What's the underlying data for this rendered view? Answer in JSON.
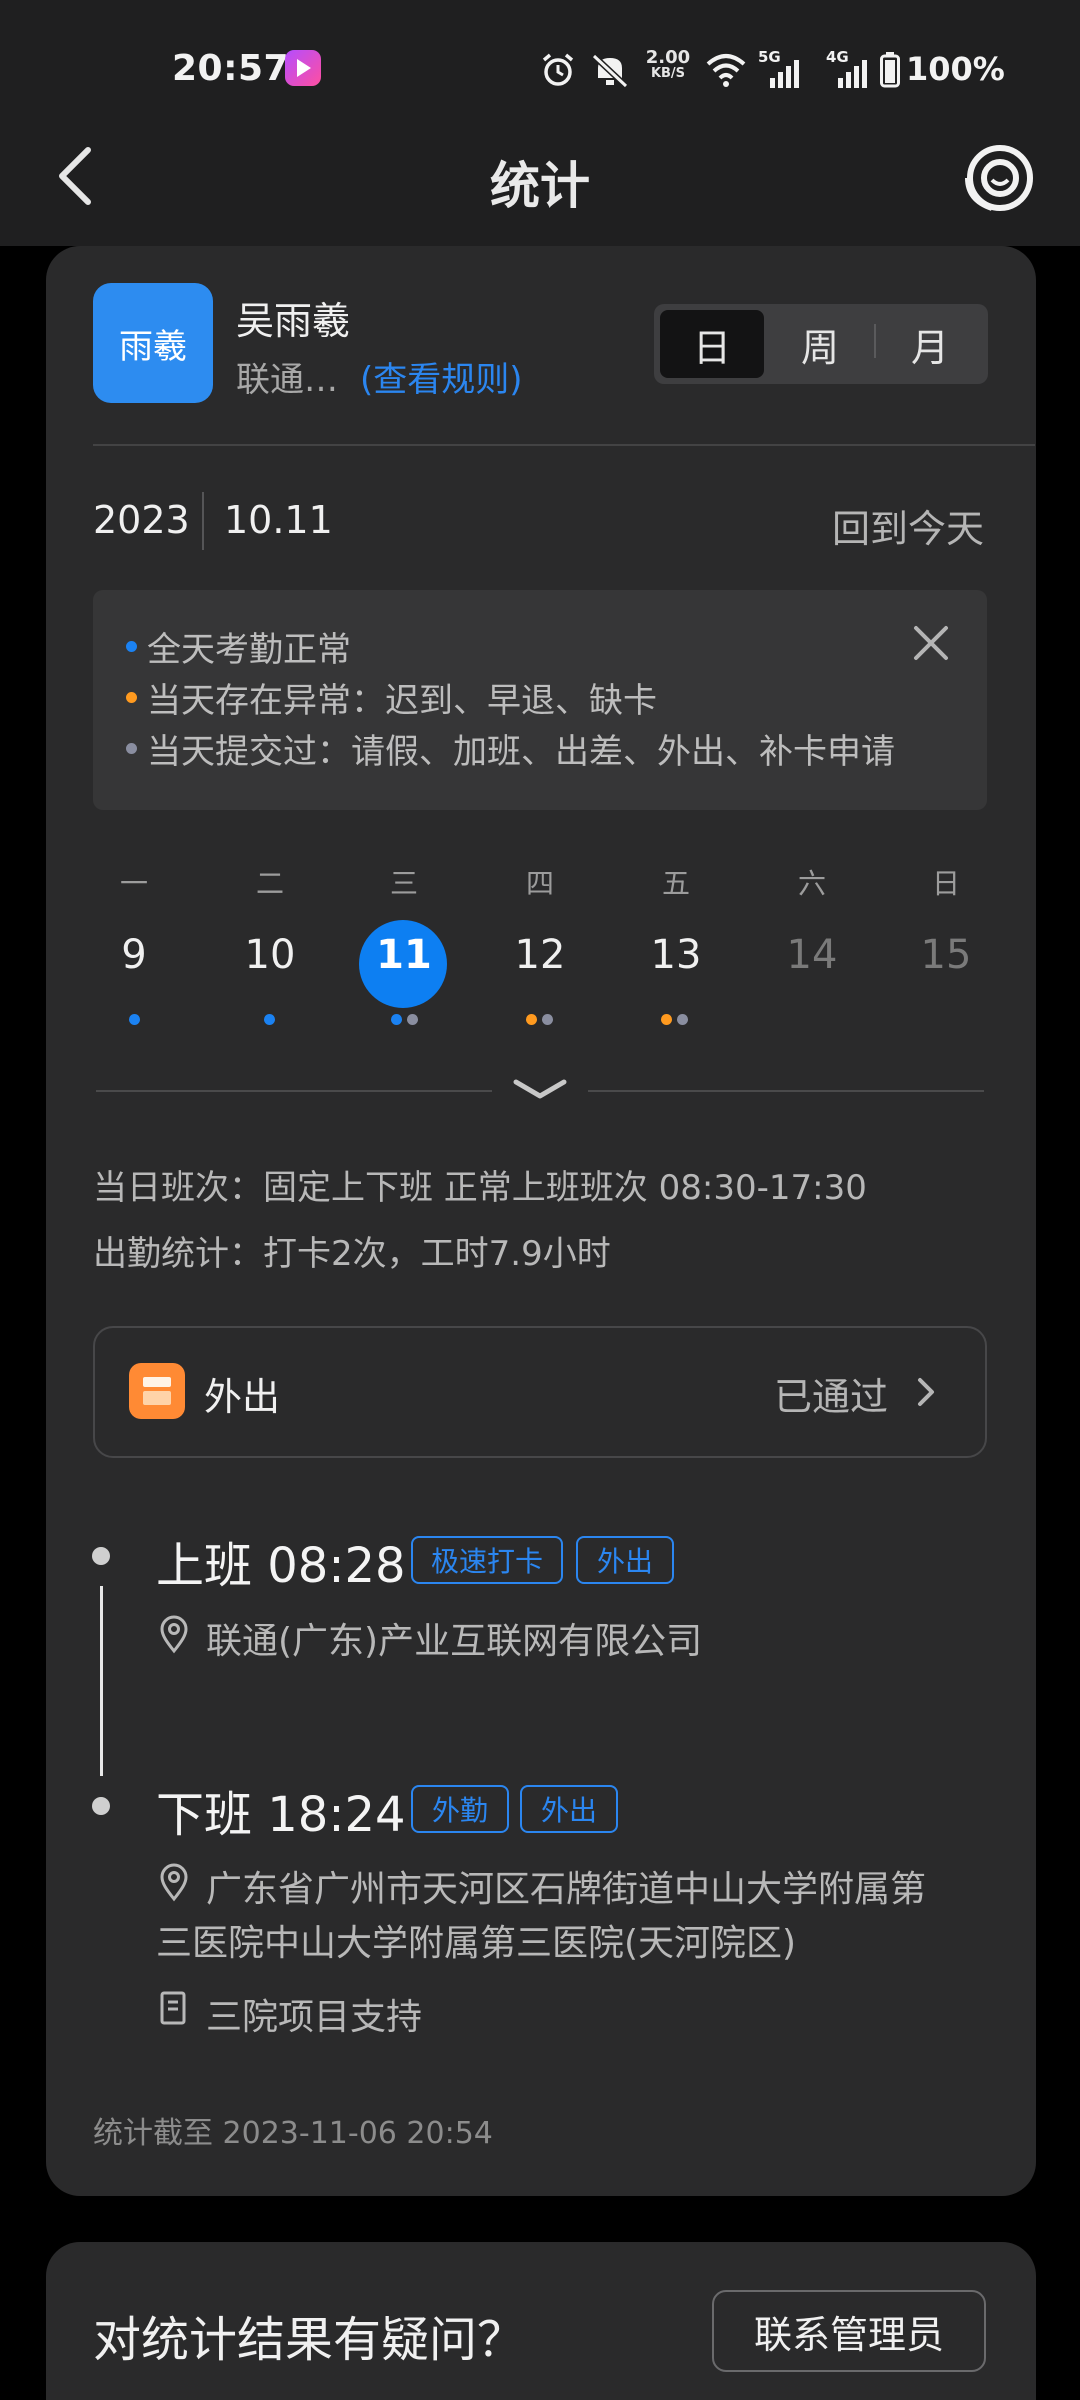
{
  "status_bar": {
    "time": "20:57",
    "net_speed_top": "2.00",
    "net_speed_bottom": "KB/S",
    "net1": "5G",
    "net2": "4G",
    "battery": "100%",
    "icons": [
      "alarm-icon",
      "mute-icon",
      "wifi-icon",
      "signal-icon",
      "battery-icon"
    ]
  },
  "header": {
    "title": "统计",
    "back_icon": "chevron-left-icon",
    "help_icon": "support-icon"
  },
  "user": {
    "avatar_text": "雨羲",
    "name": "吴雨羲",
    "org": "联通…",
    "rules_link": "(查看规则)"
  },
  "period_tabs": [
    {
      "label": "日",
      "active": true
    },
    {
      "label": "周",
      "active": false
    },
    {
      "label": "月",
      "active": false
    }
  ],
  "date": {
    "year": "2023",
    "day": "10.11",
    "back_today": "回到今天"
  },
  "legend": [
    {
      "text": "全天考勤正常",
      "color": "#1b82f2"
    },
    {
      "text": "当天存在异常：迟到、早退、缺卡",
      "color": "#ff9a1f"
    },
    {
      "text": "当天提交过：请假、加班、出差、外出、补卡申请",
      "color": "#8a8ea0"
    }
  ],
  "week": {
    "weekdays": [
      "一",
      "二",
      "三",
      "四",
      "五",
      "六",
      "日"
    ],
    "days": [
      {
        "num": "9",
        "dots": [
          "#1b82f2"
        ],
        "muted": false,
        "today": false
      },
      {
        "num": "10",
        "dots": [
          "#1b82f2"
        ],
        "muted": false,
        "today": false
      },
      {
        "num": "11",
        "dots": [
          "#1b82f2",
          "#8a8ea0"
        ],
        "muted": false,
        "today": true
      },
      {
        "num": "12",
        "dots": [
          "#ff9a1f",
          "#8a8ea0"
        ],
        "muted": false,
        "today": false
      },
      {
        "num": "13",
        "dots": [
          "#ff9a1f",
          "#8a8ea0"
        ],
        "muted": false,
        "today": false
      },
      {
        "num": "14",
        "dots": [],
        "muted": true,
        "today": false
      },
      {
        "num": "15",
        "dots": [],
        "muted": true,
        "today": false
      }
    ]
  },
  "shift_info": "当日班次：固定上下班 正常上班班次 08:30-17:30",
  "attendance_info": "出勤统计：打卡2次，工时7.9小时",
  "outing": {
    "label": "外出",
    "status": "已通过"
  },
  "punches": {
    "in": {
      "title": "上班 08:28",
      "tags": [
        "极速打卡",
        "外出"
      ],
      "location": "联通(广东)产业互联网有限公司"
    },
    "out": {
      "title": "下班 18:24",
      "tags": [
        "外勤",
        "外出"
      ],
      "location_line1": "广东省广州市天河区石牌街道中山大学附属第",
      "location_line2": "三医院中山大学附属第三医院(天河院区)",
      "note": "三院项目支持"
    }
  },
  "stat_until": "统计截至 2023-11-06 20:54",
  "footer": {
    "question": "对统计结果有疑问？",
    "contact_button": "联系管理员"
  },
  "colors": {
    "accent": "#2b86f0",
    "today": "#0d7ff2",
    "outing_icon": "#ff8a34"
  }
}
